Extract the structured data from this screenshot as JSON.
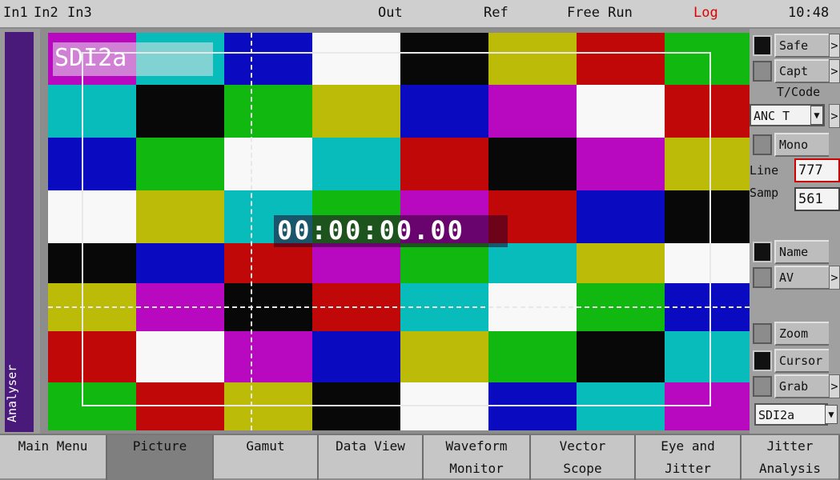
{
  "topbar": {
    "inputs": [
      "In1",
      "In2",
      "In3"
    ],
    "out": "Out",
    "ref": "Ref",
    "free_run": "Free Run",
    "log": "Log",
    "log_color": "#e00000",
    "time": "10:48"
  },
  "sidebar": {
    "label": "Analyser",
    "color": "#4a1a7a"
  },
  "picture": {
    "source_label": "SDI2a",
    "timecode": "00:00:00.00",
    "palette": {
      "W": "#f8f8f8",
      "Y": "#bcbc08",
      "C": "#08bcbc",
      "G": "#10b810",
      "M": "#b808c0",
      "R": "#c00808",
      "B": "#0a0ac0",
      "K": "#080808"
    },
    "rows": [
      [
        "M",
        "C",
        "B",
        "W",
        "K",
        "Y",
        "R",
        "G"
      ],
      [
        "C",
        "K",
        "G",
        "Y",
        "B",
        "M",
        "W",
        "R"
      ],
      [
        "B",
        "G",
        "W",
        "C",
        "R",
        "K",
        "M",
        "Y"
      ],
      [
        "W",
        "Y",
        "C",
        "G",
        "M",
        "R",
        "B",
        "K"
      ],
      [
        "K",
        "B",
        "R",
        "M",
        "G",
        "C",
        "Y",
        "W"
      ],
      [
        "Y",
        "M",
        "K",
        "R",
        "C",
        "W",
        "G",
        "B"
      ],
      [
        "R",
        "W",
        "M",
        "B",
        "Y",
        "G",
        "K",
        "C"
      ],
      [
        "G",
        "R",
        "Y",
        "K",
        "W",
        "B",
        "C",
        "M"
      ]
    ]
  },
  "right_panel": {
    "safe": {
      "label": "Safe",
      "checked": true
    },
    "capt": {
      "label": "Capt",
      "checked": false
    },
    "tcode_label": "T/Code",
    "tcode_select": "ANC T",
    "mono": {
      "label": "Mono",
      "checked": false
    },
    "line_label": "Line",
    "line_value": "777",
    "samp_label": "Samp",
    "samp_value": "561",
    "name": {
      "label": "Name",
      "checked": true
    },
    "av": {
      "label": "AV",
      "checked": false
    },
    "zoom": {
      "label": "Zoom",
      "checked": false
    },
    "cursor": {
      "label": "Cursor",
      "checked": true
    },
    "grab": {
      "label": "Grab",
      "checked": false
    },
    "source_select": "SDI2a",
    "arrow_glyph": ">",
    "dropdown_glyph": "▼"
  },
  "bottom_tabs": [
    {
      "line1": "Main Menu",
      "line2": "",
      "active": false
    },
    {
      "line1": "Picture",
      "line2": "",
      "active": true
    },
    {
      "line1": "Gamut",
      "line2": "",
      "active": false
    },
    {
      "line1": "Data View",
      "line2": "",
      "active": false
    },
    {
      "line1": "Waveform",
      "line2": "Monitor",
      "active": false
    },
    {
      "line1": "Vector",
      "line2": "Scope",
      "active": false
    },
    {
      "line1": "Eye and",
      "line2": "Jitter",
      "active": false
    },
    {
      "line1": "Jitter",
      "line2": "Analysis",
      "active": false
    }
  ]
}
